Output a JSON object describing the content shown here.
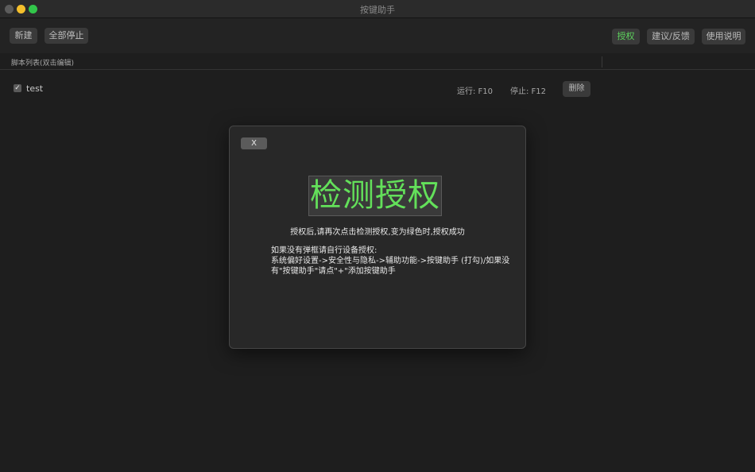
{
  "window": {
    "title": "按键助手"
  },
  "toolbar": {
    "new_label": "新建",
    "stop_all_label": "全部停止",
    "auth_label": "授权",
    "feedback_label": "建议/反馈",
    "help_label": "使用说明"
  },
  "list": {
    "header": "脚本列表(双击编辑)",
    "scripts": [
      {
        "checked": true,
        "name": "test",
        "run_hotkey": "运行:  F10",
        "stop_hotkey": "停止:  F12",
        "delete_label": "删除"
      }
    ]
  },
  "modal": {
    "close_label": "X",
    "detect_label": "检测授权",
    "hint": "授权后,请再次点击检测授权,变为绿色时,授权成功",
    "manual_lines": [
      "如果没有弹框请自行设备授权:",
      "系统偏好设置->安全性与隐私->辅助功能->按键助手 (打勾)/如果没",
      "有\"按键助手\"请点\"+\"添加按键助手"
    ]
  },
  "colors": {
    "accent_green": "#5dd35d",
    "detect_text": "#63e05a",
    "traffic_min": "#f4bf2c",
    "traffic_max": "#32c64a"
  }
}
